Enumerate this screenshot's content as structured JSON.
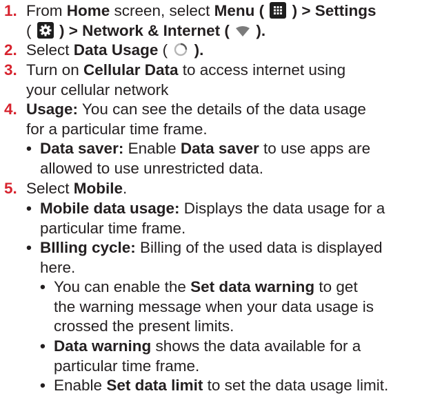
{
  "steps": [
    {
      "number": "1.",
      "line1": {
        "t1": "From ",
        "home": "Home",
        "t2": " screen, select ",
        "menu": "Menu",
        "open1": " ( ",
        "close1": " ) > Settings"
      },
      "line2": {
        "open2": "( ",
        "close2": " ) > Network & Internet ( ",
        "close3": " )."
      },
      "icons": [
        "menu-grid-icon",
        "settings-gear-icon",
        "wifi-wedge-icon"
      ]
    },
    {
      "number": "2.",
      "t1": "Select ",
      "bold": "Data Usage",
      "t2": " ( ",
      "t3": " ).",
      "icons": [
        "data-usage-ring-icon"
      ]
    },
    {
      "number": "3.",
      "t1": "Turn on ",
      "bold": "Cellular Data",
      "t2": " to access internet using",
      "line2": "your cellular network"
    },
    {
      "number": "4.",
      "bold": "Usage:",
      "t1": " You can see the details of the data usage",
      "line2": "for a particular time frame.",
      "bullets": [
        {
          "bullet": "•",
          "bold1": "Data saver:",
          "t1": " Enable ",
          "bold2": "Data saver",
          "t2": " to use apps are",
          "line2": "allowed to use unrestricted data."
        }
      ]
    },
    {
      "number": "5.",
      "t1": "Select ",
      "bold": "Mobile",
      "t2": ".",
      "bullets": [
        {
          "bullet": "•",
          "bold": "Mobile data usage:",
          "t1": " Displays the data usage for a",
          "line2": "particular time frame."
        },
        {
          "bullet": "•",
          "bold": "BIlling cycle:",
          "t1": " Billing of the used data is displayed",
          "line2": "here.",
          "subbullets": [
            {
              "bullet": "•",
              "t1": "You can enable the ",
              "bold": "Set data warning",
              "t2": " to get",
              "line2": "the warning message when your data usage is",
              "line3": "crossed the present limits."
            },
            {
              "bullet": "•",
              "bold": "Data warning",
              "t1": " shows the data available for a",
              "line2": "particular time frame."
            },
            {
              "bullet": "•",
              "t1": "Enable ",
              "bold": "Set data limit",
              "t2": " to set the data usage limit."
            }
          ]
        }
      ]
    }
  ],
  "colors": {
    "number": "#d7232e",
    "text": "#231f20",
    "icon_bg": "#1e1e1e"
  }
}
